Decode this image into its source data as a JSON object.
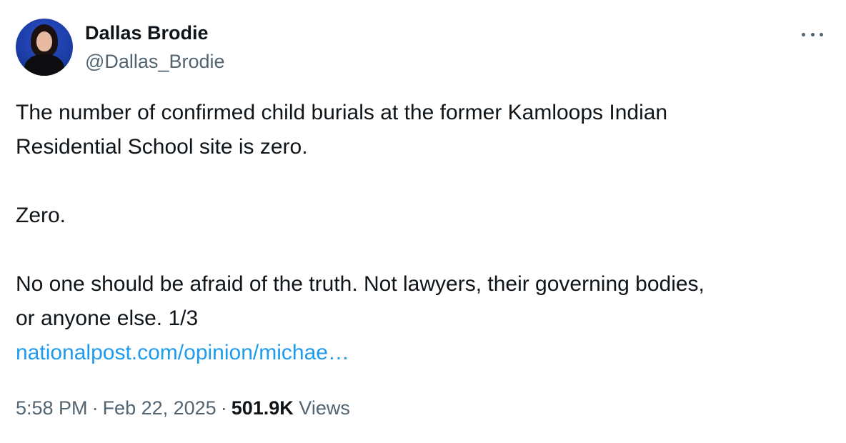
{
  "author": {
    "display_name": "Dallas Brodie",
    "handle": "@Dallas_Brodie",
    "avatar_icon": "profile-photo"
  },
  "menu": {
    "icon": "more-options-icon"
  },
  "tweet": {
    "line1": "The number of confirmed child burials at the former Kamloops Indian",
    "line2": "Residential School site is zero.",
    "line3": "Zero.",
    "line4": "No one should be afraid of the truth. Not lawyers, their governing bodies,",
    "line5": "or anyone else. 1/3",
    "link_text": "nationalpost.com/opinion/michae…"
  },
  "meta": {
    "time": "5:58 PM",
    "separator": "·",
    "date": "Feb 22, 2025",
    "views_count": "501.9K",
    "views_label": "Views"
  },
  "colors": {
    "text": "#0f1419",
    "secondary": "#536471",
    "link": "#1d9bf0",
    "avatar_bg": "#1d3ea8"
  }
}
